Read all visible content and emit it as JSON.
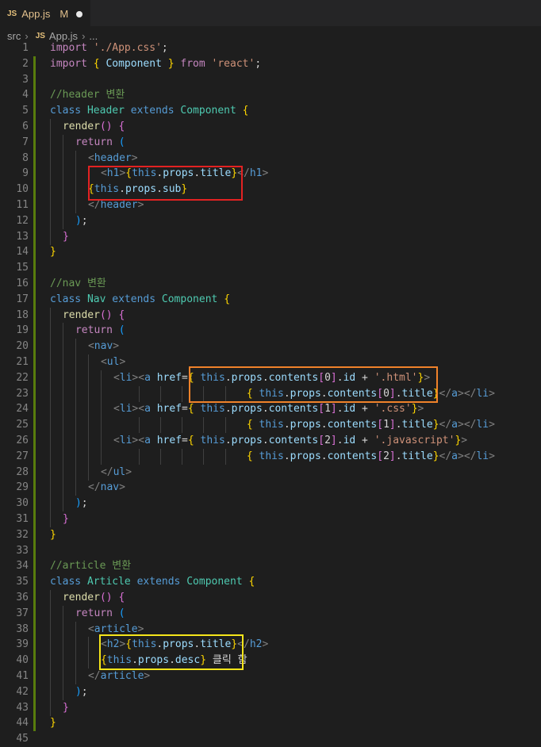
{
  "tab": {
    "icon": "JS",
    "name": "App.js",
    "status": "M"
  },
  "breadcrumb": [
    "src",
    "App.js",
    "..."
  ],
  "colors": {
    "red_box": "#e32222",
    "orange_box": "#f0822a",
    "yellow_box": "#f5e51a",
    "modified_bar": "#587c0c"
  },
  "lines": [
    {
      "n": "1",
      "t": [
        [
          "kw",
          "import "
        ],
        [
          "str",
          "'./App.css'"
        ],
        [
          "pl",
          ";"
        ]
      ]
    },
    {
      "n": "2",
      "t": [
        [
          "kw",
          "import "
        ],
        [
          "br",
          "{ "
        ],
        [
          "v",
          "Component"
        ],
        [
          "br",
          " }"
        ],
        [
          "kw",
          " from "
        ],
        [
          "str",
          "'react'"
        ],
        [
          "pl",
          ";"
        ]
      ]
    },
    {
      "n": "3",
      "t": []
    },
    {
      "n": "4",
      "t": [
        [
          "cm",
          "//header 변환"
        ]
      ]
    },
    {
      "n": "5",
      "t": [
        [
          "kb",
          "class "
        ],
        [
          "cls",
          "Header "
        ],
        [
          "kb",
          "extends "
        ],
        [
          "cls",
          "Component "
        ],
        [
          "br",
          "{"
        ]
      ]
    },
    {
      "n": "6",
      "i": 1,
      "t": [
        [
          "fn",
          "render"
        ],
        [
          "br2",
          "() "
        ],
        [
          "br2",
          "{"
        ]
      ]
    },
    {
      "n": "7",
      "i": 2,
      "t": [
        [
          "kw",
          "return "
        ],
        [
          "br3",
          "("
        ]
      ]
    },
    {
      "n": "8",
      "i": 3,
      "t": [
        [
          "tp",
          "<"
        ],
        [
          "tg",
          "header"
        ],
        [
          "tp",
          ">"
        ]
      ]
    },
    {
      "n": "9",
      "i": 4,
      "t": [
        [
          "tp",
          "<"
        ],
        [
          "tg",
          "h1"
        ],
        [
          "tp",
          ">"
        ],
        [
          "br",
          "{"
        ],
        [
          "kb",
          "this"
        ],
        [
          "pl",
          "."
        ],
        [
          "v",
          "props"
        ],
        [
          "pl",
          "."
        ],
        [
          "v",
          "title"
        ],
        [
          "br",
          "}"
        ],
        [
          "tp",
          "</"
        ],
        [
          "tg",
          "h1"
        ],
        [
          "tp",
          ">"
        ]
      ]
    },
    {
      "n": "10",
      "i": 3,
      "t": [
        [
          "br",
          "{"
        ],
        [
          "kb",
          "this"
        ],
        [
          "pl",
          "."
        ],
        [
          "v",
          "props"
        ],
        [
          "pl",
          "."
        ],
        [
          "v",
          "sub"
        ],
        [
          "br",
          "}"
        ]
      ]
    },
    {
      "n": "11",
      "i": 3,
      "t": [
        [
          "tp",
          "</"
        ],
        [
          "tg",
          "header"
        ],
        [
          "tp",
          ">"
        ]
      ]
    },
    {
      "n": "12",
      "i": 2,
      "t": [
        [
          "br3",
          ")"
        ],
        [
          "pl",
          ";"
        ]
      ]
    },
    {
      "n": "13",
      "i": 1,
      "t": [
        [
          "br2",
          "}"
        ]
      ]
    },
    {
      "n": "14",
      "t": [
        [
          "br",
          "}"
        ]
      ]
    },
    {
      "n": "15",
      "t": []
    },
    {
      "n": "16",
      "t": [
        [
          "cm",
          "//nav 변환"
        ]
      ]
    },
    {
      "n": "17",
      "t": [
        [
          "kb",
          "class "
        ],
        [
          "cls",
          "Nav "
        ],
        [
          "kb",
          "extends "
        ],
        [
          "cls",
          "Component "
        ],
        [
          "br",
          "{"
        ]
      ]
    },
    {
      "n": "18",
      "i": 1,
      "t": [
        [
          "fn",
          "render"
        ],
        [
          "br2",
          "() "
        ],
        [
          "br2",
          "{"
        ]
      ]
    },
    {
      "n": "19",
      "i": 2,
      "t": [
        [
          "kw",
          "return "
        ],
        [
          "br3",
          "("
        ]
      ]
    },
    {
      "n": "20",
      "i": 3,
      "t": [
        [
          "tp",
          "<"
        ],
        [
          "tg",
          "nav"
        ],
        [
          "tp",
          ">"
        ]
      ]
    },
    {
      "n": "21",
      "i": 4,
      "t": [
        [
          "tp",
          "<"
        ],
        [
          "tg",
          "ul"
        ],
        [
          "tp",
          ">"
        ]
      ]
    },
    {
      "n": "22",
      "i": 5,
      "t": [
        [
          "tp",
          "<"
        ],
        [
          "tg",
          "li"
        ],
        [
          "tp",
          "><"
        ],
        [
          "tg",
          "a "
        ],
        [
          "at",
          "href"
        ],
        [
          "pl",
          "="
        ],
        [
          "br",
          "{ "
        ],
        [
          "kb",
          "this"
        ],
        [
          "pl",
          "."
        ],
        [
          "v",
          "props"
        ],
        [
          "pl",
          "."
        ],
        [
          "v",
          "contents"
        ],
        [
          "br2",
          "["
        ],
        [
          "pl",
          "0"
        ],
        [
          "br2",
          "]"
        ],
        [
          "pl",
          "."
        ],
        [
          "v",
          "id"
        ],
        [
          "pl",
          " + "
        ],
        [
          "str",
          "'.html'"
        ],
        [
          "br",
          "}"
        ],
        [
          "tp",
          ">"
        ]
      ]
    },
    {
      "n": "23",
      "i": 5,
      "ex": "                     ",
      "t": [
        [
          "br",
          "{ "
        ],
        [
          "kb",
          "this"
        ],
        [
          "pl",
          "."
        ],
        [
          "v",
          "props"
        ],
        [
          "pl",
          "."
        ],
        [
          "v",
          "contents"
        ],
        [
          "br2",
          "["
        ],
        [
          "pl",
          "0"
        ],
        [
          "br2",
          "]"
        ],
        [
          "pl",
          "."
        ],
        [
          "v",
          "title"
        ],
        [
          "br",
          "}"
        ],
        [
          "tp",
          "</"
        ],
        [
          "tg",
          "a"
        ],
        [
          "tp",
          "></"
        ],
        [
          "tg",
          "li"
        ],
        [
          "tp",
          ">"
        ]
      ]
    },
    {
      "n": "24",
      "i": 5,
      "t": [
        [
          "tp",
          "<"
        ],
        [
          "tg",
          "li"
        ],
        [
          "tp",
          "><"
        ],
        [
          "tg",
          "a "
        ],
        [
          "at",
          "href"
        ],
        [
          "pl",
          "="
        ],
        [
          "br",
          "{ "
        ],
        [
          "kb",
          "this"
        ],
        [
          "pl",
          "."
        ],
        [
          "v",
          "props"
        ],
        [
          "pl",
          "."
        ],
        [
          "v",
          "contents"
        ],
        [
          "br2",
          "["
        ],
        [
          "pl",
          "1"
        ],
        [
          "br2",
          "]"
        ],
        [
          "pl",
          "."
        ],
        [
          "v",
          "id"
        ],
        [
          "pl",
          " + "
        ],
        [
          "str",
          "'.css'"
        ],
        [
          "br",
          "}"
        ],
        [
          "tp",
          ">"
        ]
      ]
    },
    {
      "n": "25",
      "i": 5,
      "ex": "                     ",
      "t": [
        [
          "br",
          "{ "
        ],
        [
          "kb",
          "this"
        ],
        [
          "pl",
          "."
        ],
        [
          "v",
          "props"
        ],
        [
          "pl",
          "."
        ],
        [
          "v",
          "contents"
        ],
        [
          "br2",
          "["
        ],
        [
          "pl",
          "1"
        ],
        [
          "br2",
          "]"
        ],
        [
          "pl",
          "."
        ],
        [
          "v",
          "title"
        ],
        [
          "br",
          "}"
        ],
        [
          "tp",
          "</"
        ],
        [
          "tg",
          "a"
        ],
        [
          "tp",
          "></"
        ],
        [
          "tg",
          "li"
        ],
        [
          "tp",
          ">"
        ]
      ]
    },
    {
      "n": "26",
      "i": 5,
      "t": [
        [
          "tp",
          "<"
        ],
        [
          "tg",
          "li"
        ],
        [
          "tp",
          "><"
        ],
        [
          "tg",
          "a "
        ],
        [
          "at",
          "href"
        ],
        [
          "pl",
          "="
        ],
        [
          "br",
          "{ "
        ],
        [
          "kb",
          "this"
        ],
        [
          "pl",
          "."
        ],
        [
          "v",
          "props"
        ],
        [
          "pl",
          "."
        ],
        [
          "v",
          "contents"
        ],
        [
          "br2",
          "["
        ],
        [
          "pl",
          "2"
        ],
        [
          "br2",
          "]"
        ],
        [
          "pl",
          "."
        ],
        [
          "v",
          "id"
        ],
        [
          "pl",
          " + "
        ],
        [
          "str",
          "'.javascript'"
        ],
        [
          "br",
          "}"
        ],
        [
          "tp",
          ">"
        ]
      ]
    },
    {
      "n": "27",
      "i": 5,
      "ex": "                     ",
      "t": [
        [
          "br",
          "{ "
        ],
        [
          "kb",
          "this"
        ],
        [
          "pl",
          "."
        ],
        [
          "v",
          "props"
        ],
        [
          "pl",
          "."
        ],
        [
          "v",
          "contents"
        ],
        [
          "br2",
          "["
        ],
        [
          "pl",
          "2"
        ],
        [
          "br2",
          "]"
        ],
        [
          "pl",
          "."
        ],
        [
          "v",
          "title"
        ],
        [
          "br",
          "}"
        ],
        [
          "tp",
          "</"
        ],
        [
          "tg",
          "a"
        ],
        [
          "tp",
          "></"
        ],
        [
          "tg",
          "li"
        ],
        [
          "tp",
          ">"
        ]
      ]
    },
    {
      "n": "28",
      "i": 4,
      "t": [
        [
          "tp",
          "</"
        ],
        [
          "tg",
          "ul"
        ],
        [
          "tp",
          ">"
        ]
      ]
    },
    {
      "n": "29",
      "i": 3,
      "t": [
        [
          "tp",
          "</"
        ],
        [
          "tg",
          "nav"
        ],
        [
          "tp",
          ">"
        ]
      ]
    },
    {
      "n": "30",
      "i": 2,
      "t": [
        [
          "br3",
          ")"
        ],
        [
          "pl",
          ";"
        ]
      ]
    },
    {
      "n": "31",
      "i": 1,
      "t": [
        [
          "br2",
          "}"
        ]
      ]
    },
    {
      "n": "32",
      "t": [
        [
          "br",
          "}"
        ]
      ]
    },
    {
      "n": "33",
      "t": []
    },
    {
      "n": "34",
      "t": [
        [
          "cm",
          "//article 변환"
        ]
      ]
    },
    {
      "n": "35",
      "t": [
        [
          "kb",
          "class "
        ],
        [
          "cls",
          "Article "
        ],
        [
          "kb",
          "extends "
        ],
        [
          "cls",
          "Component "
        ],
        [
          "br",
          "{"
        ]
      ]
    },
    {
      "n": "36",
      "i": 1,
      "t": [
        [
          "fn",
          "render"
        ],
        [
          "br2",
          "() "
        ],
        [
          "br2",
          "{"
        ]
      ]
    },
    {
      "n": "37",
      "i": 2,
      "t": [
        [
          "kw",
          "return "
        ],
        [
          "br3",
          "("
        ]
      ]
    },
    {
      "n": "38",
      "i": 3,
      "t": [
        [
          "tp",
          "<"
        ],
        [
          "tg",
          "article"
        ],
        [
          "tp",
          ">"
        ]
      ]
    },
    {
      "n": "39",
      "i": 4,
      "t": [
        [
          "tp",
          "<"
        ],
        [
          "tg",
          "h2"
        ],
        [
          "tp",
          ">"
        ],
        [
          "br",
          "{"
        ],
        [
          "kb",
          "this"
        ],
        [
          "pl",
          "."
        ],
        [
          "v",
          "props"
        ],
        [
          "pl",
          "."
        ],
        [
          "v",
          "title"
        ],
        [
          "br",
          "}"
        ],
        [
          "tp",
          "</"
        ],
        [
          "tg",
          "h2"
        ],
        [
          "tp",
          ">"
        ]
      ]
    },
    {
      "n": "40",
      "i": 4,
      "t": [
        [
          "br",
          "{"
        ],
        [
          "kb",
          "this"
        ],
        [
          "pl",
          "."
        ],
        [
          "v",
          "props"
        ],
        [
          "pl",
          "."
        ],
        [
          "v",
          "desc"
        ],
        [
          "br",
          "}"
        ],
        [
          "pl",
          " 클릭 함"
        ]
      ]
    },
    {
      "n": "41",
      "i": 3,
      "t": [
        [
          "tp",
          "</"
        ],
        [
          "tg",
          "article"
        ],
        [
          "tp",
          ">"
        ]
      ]
    },
    {
      "n": "42",
      "i": 2,
      "t": [
        [
          "br3",
          ")"
        ],
        [
          "pl",
          ";"
        ]
      ]
    },
    {
      "n": "43",
      "i": 1,
      "t": [
        [
          "br2",
          "}"
        ]
      ]
    },
    {
      "n": "44",
      "t": [
        [
          "br",
          "}"
        ]
      ]
    },
    {
      "n": "45",
      "t": []
    }
  ]
}
